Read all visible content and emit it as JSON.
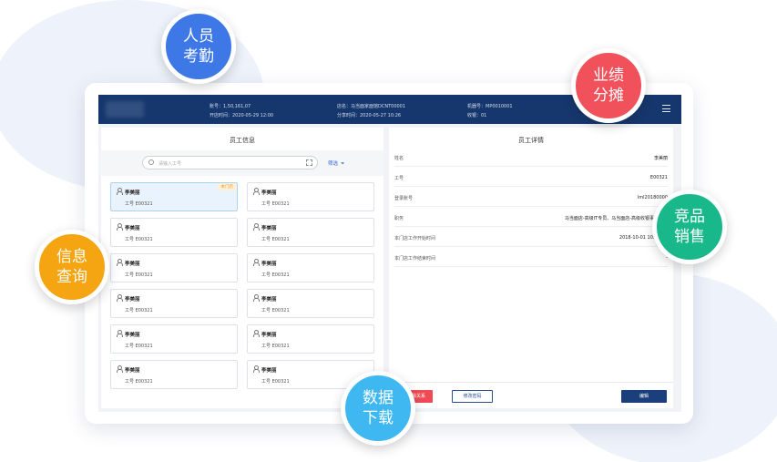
{
  "topbar": {
    "store_no": "账号：1,50,161,07",
    "open_time": "开店时间：2020-05-29 12:00",
    "store_name": "店名：马当面家面馆DCNT00001",
    "shift_time": "分享时间：2020-05-27 10:26",
    "machine_no": "机器号：MP0010001",
    "cashier": "收银：01"
  },
  "left_panel": {
    "title": "员工信息",
    "search_placeholder": "请输入工号",
    "filter_label": "筛选",
    "cards": [
      {
        "name": "李美丽",
        "no": "工号 E00321",
        "badge": "本门店"
      },
      {
        "name": "李美丽",
        "no": "工号 E00321",
        "badge": ""
      },
      {
        "name": "李美丽",
        "no": "工号 E00321",
        "badge": ""
      },
      {
        "name": "李美丽",
        "no": "工号 E00321",
        "badge": ""
      },
      {
        "name": "李美丽",
        "no": "工号 E00321",
        "badge": ""
      },
      {
        "name": "李美丽",
        "no": "工号 E00321",
        "badge": ""
      },
      {
        "name": "李美丽",
        "no": "工号 E00321",
        "badge": ""
      },
      {
        "name": "李美丽",
        "no": "工号 E00321",
        "badge": ""
      },
      {
        "name": "李美丽",
        "no": "工号 E00321",
        "badge": ""
      },
      {
        "name": "李美丽",
        "no": "工号 E00321",
        "badge": ""
      },
      {
        "name": "李美丽",
        "no": "工号 E00321",
        "badge": ""
      },
      {
        "name": "李美丽",
        "no": "工号 E00321",
        "badge": ""
      }
    ]
  },
  "right_panel": {
    "title": "员工详情",
    "rows": [
      {
        "label": "姓名",
        "value": "李美丽"
      },
      {
        "label": "工号",
        "value": "E00321"
      },
      {
        "label": "登录账号",
        "value": "lml20180000"
      },
      {
        "label": "职务",
        "value": "马当面店-高级IT专员、马当面店-高级收银事务专员"
      },
      {
        "label": "本门店工作开始时间",
        "value": "2018-10-01  10:00:00"
      },
      {
        "label": "本门店工作结束时间",
        "value": "-"
      }
    ],
    "btn_remove": "删除关系",
    "btn_password": "修改密码",
    "btn_edit": "编辑"
  },
  "bubbles": {
    "attendance": [
      "人员",
      "考勤"
    ],
    "performance": [
      "业绩",
      "分摊"
    ],
    "competitor": [
      "竞品",
      "销售"
    ],
    "query": [
      "信息",
      "查询"
    ],
    "download": [
      "数据",
      "下载"
    ]
  },
  "colors": {
    "topbar": "#16376e",
    "blue_bubble": "#3e77e6",
    "red_bubble": "#f0515a",
    "green_bubble": "#19b88a",
    "orange_bubble": "#f5a412",
    "cyan_bubble": "#3fb8f2"
  }
}
